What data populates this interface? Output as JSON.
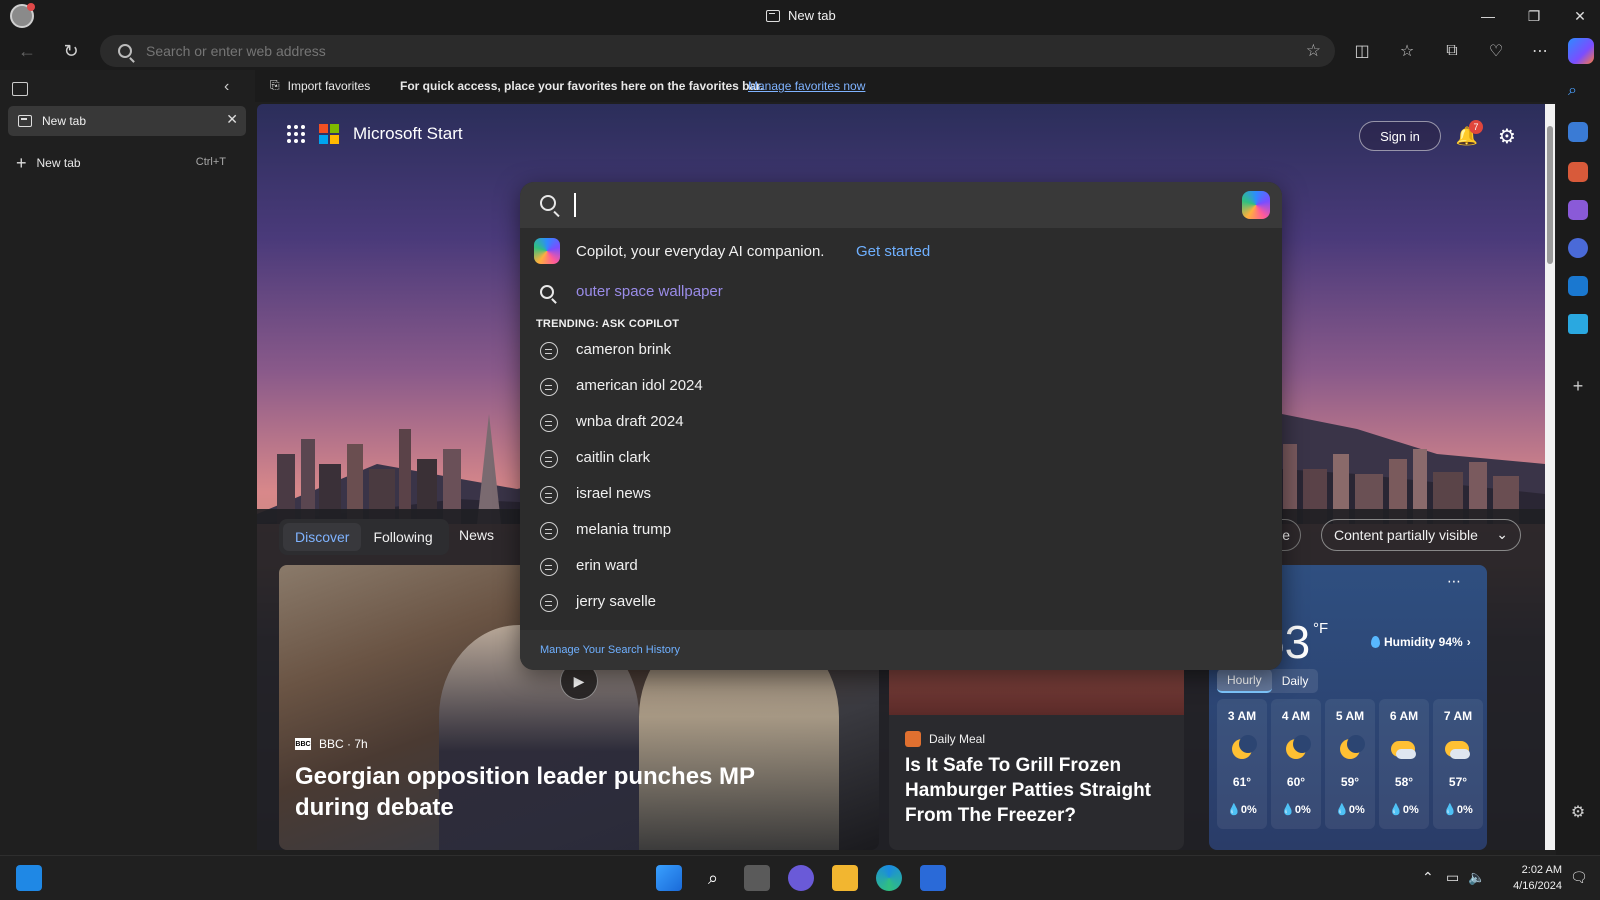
{
  "window": {
    "title": "New tab",
    "controls": {
      "minimize": "—",
      "restore": "❐",
      "close": "✕"
    }
  },
  "toolbar": {
    "address_placeholder": "Search or enter web address"
  },
  "favorites_bar": {
    "import_label": "Import favorites",
    "message": "For quick access, place your favorites here on the favorites bar.",
    "manage_link": "Manage favorites now"
  },
  "vertical_tabs": {
    "active_tab": "New tab",
    "new_tab_label": "New tab",
    "new_tab_shortcut": "Ctrl+T"
  },
  "ms_start": {
    "brand": "Microsoft Start",
    "sign_in": "Sign in",
    "notification_count": "7"
  },
  "search": {
    "copilot_text": "Copilot, your everyday AI companion.",
    "copilot_link": "Get started",
    "recent": "outer space wallpaper",
    "trending_heading": "TRENDING: ASK COPILOT",
    "trending": [
      "cameron brink",
      "american idol 2024",
      "wnba draft 2024",
      "caitlin clark",
      "israel news",
      "melania trump",
      "erin ward",
      "jerry savelle"
    ],
    "manage_history": "Manage Your Search History"
  },
  "feed": {
    "tabs": [
      "Discover",
      "Following"
    ],
    "news_tab": "News",
    "personalize_fragment": "lize",
    "content_visibility": "Content partially visible"
  },
  "card_main": {
    "source": "BBC · 7h",
    "source_logo": "BBC",
    "headline": "Georgian opposition leader punches MP during debate"
  },
  "card_2": {
    "source": "Daily Meal",
    "headline": "Is It Safe To Grill Frozen Hamburger Patties Straight From The Freezer?"
  },
  "weather": {
    "temperature": "63",
    "unit": "°F",
    "humidity": "Humidity 94%",
    "tabs": [
      "Hourly",
      "Daily"
    ],
    "hours": [
      {
        "time": "3 AM",
        "temp": "61°",
        "precip": "0%",
        "icon": "moon-icon"
      },
      {
        "time": "4 AM",
        "temp": "60°",
        "precip": "0%",
        "icon": "moon-icon"
      },
      {
        "time": "5 AM",
        "temp": "59°",
        "precip": "0%",
        "icon": "moon-icon"
      },
      {
        "time": "6 AM",
        "temp": "58°",
        "precip": "0%",
        "icon": "partly-cloudy-icon"
      },
      {
        "time": "7 AM",
        "temp": "57°",
        "precip": "0%",
        "icon": "partly-cloudy-icon"
      }
    ]
  },
  "taskbar": {
    "time": "2:02 AM",
    "date": "4/16/2024"
  }
}
